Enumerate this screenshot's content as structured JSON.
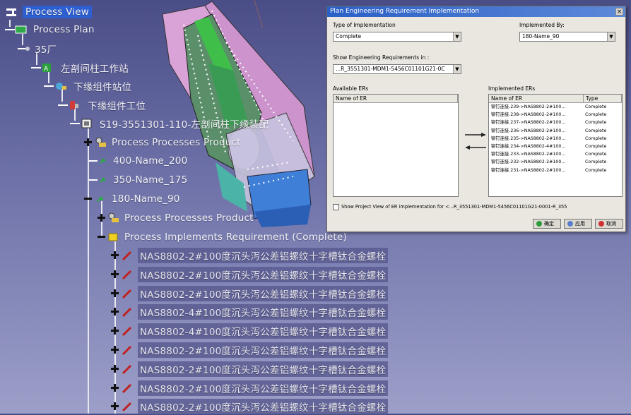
{
  "tree": {
    "root": "Process View",
    "plan": "Process Plan",
    "plant": "35厂",
    "station1": "左剖间柱工作站",
    "station2": "下缘组件站位",
    "station3": "下缘组件工位",
    "assembly": "S19-3551301-110-左剖间柱下缘装配",
    "ppp1": "Process Processes Product",
    "op1": "400-Name_200",
    "op2": "350-Name_175",
    "op3": "180-Name_90",
    "ppp2": "Process Processes Product",
    "pir": "Process Implements Requirement (Complete)",
    "requirements": [
      "NAS8802-2#100度沉头泻公差铝螺纹十字槽钛合金螺栓",
      "NAS8802-2#100度沉头泻公差铝螺纹十字槽钛合金螺栓",
      "NAS8802-2#100度沉头泻公差铝螺纹十字槽钛合金螺栓",
      "NAS8802-4#100度沉头泻公差铝螺纹十字槽钛合金螺栓",
      "NAS8802-4#100度沉头泻公差铝螺纹十字槽钛合金螺栓",
      "NAS8802-2#100度沉头泻公差铝螺纹十字槽钛合金螺栓",
      "NAS8802-2#100度沉头泻公差铝螺纹十字槽钛合金螺栓",
      "NAS8802-2#100度沉头泻公差铝螺纹十字槽钛合金螺栓",
      "NAS8802-2#100度沉头泻公差铝螺纹十字槽钛合金螺栓"
    ]
  },
  "dialog": {
    "title": "Plan Engineering Requirement Implementation",
    "type_label": "Type of Implementation",
    "type_value": "Complete",
    "impl_by_label": "Implemented By:",
    "impl_by_value": "180-Name_90",
    "show_label": "Show Engineering Requirements in :",
    "show_value": "...R_3551301-MDM1-5456C01101G21-0C",
    "available_label": "Available ERs",
    "available_col": "Name of ER",
    "implemented_label": "Implemented ERs",
    "implemented_cols": [
      "Name of ER",
      "Type"
    ],
    "implemented_rows": [
      {
        "name": "铆钉连接.239->NAS8802-2#100...",
        "type": "Complete"
      },
      {
        "name": "铆钉连接.238->NAS8802-2#100...",
        "type": "Complete"
      },
      {
        "name": "铆钉连接.237->NAS8802-2#100...",
        "type": "Complete"
      },
      {
        "name": "铆钉连接.236->NAS8802-2#100...",
        "type": "Complete"
      },
      {
        "name": "铆钉连接.235->NAS8802-2#100...",
        "type": "Complete"
      },
      {
        "name": "铆钉连接.234->NAS8802-4#100...",
        "type": "Complete"
      },
      {
        "name": "铆钉连接.233->NAS8802-2#100...",
        "type": "Complete"
      },
      {
        "name": "铆钉连接.232->NAS8802-2#100...",
        "type": "Complete"
      },
      {
        "name": "铆钉连接.231->NAS8802-2#100...",
        "type": "Complete"
      }
    ],
    "checkbox_label": "Show Project View of ER implementation for <...R_3551301-MDM1-5456C01101G21-0001-R_355",
    "ok_label": "确定",
    "apply_label": "应用",
    "cancel_label": "取消"
  }
}
